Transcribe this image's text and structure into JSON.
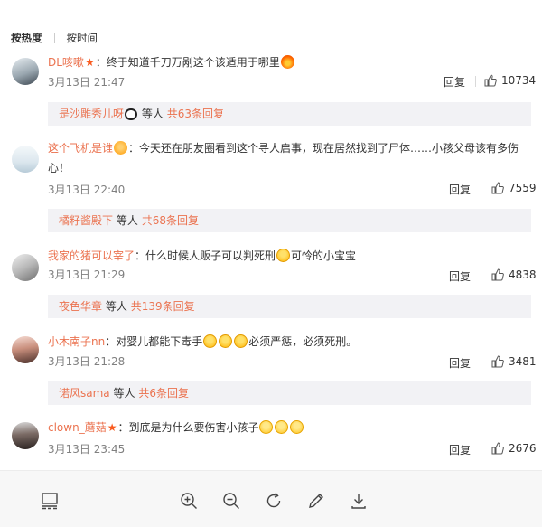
{
  "tabs": {
    "hot": "按热度",
    "time": "按时间"
  },
  "comments": [
    {
      "username": "DL咳嗽",
      "text": "：终于知道千刀万剐这个该适用于哪里",
      "time": "3月13日 21:47",
      "reply_label": "回复",
      "likes": "10734",
      "sub_name": "是沙雕秀儿呀",
      "sub_mid": "等人",
      "sub_more": "共63条回复"
    },
    {
      "username": "这个飞机是谁",
      "text": "：今天还在朋友圈看到这个寻人启事，现在居然找到了尸体……小孩父母该有多伤心！",
      "time": "3月13日 22:40",
      "reply_label": "回复",
      "likes": "7559",
      "sub_name": "橘籽酱殿下",
      "sub_mid": "等人",
      "sub_more": "共68条回复"
    },
    {
      "username": "我家的猪可以宰了",
      "text": "：什么时候人贩子可以判死刑",
      "text2": "可怜的小宝宝",
      "time": "3月13日 21:29",
      "reply_label": "回复",
      "likes": "4838",
      "sub_name": "夜色华章",
      "sub_mid": "等人",
      "sub_more": "共139条回复"
    },
    {
      "username": "小木南子nn",
      "text": "：对婴儿都能下毒手",
      "text2": "必须严惩，必须死刑。",
      "time": "3月13日 21:28",
      "reply_label": "回复",
      "likes": "3481",
      "sub_name": "诺风sama",
      "sub_mid": "等人",
      "sub_more": "共6条回复"
    },
    {
      "username": "clown_蘑菇",
      "text": "：到底是为什么要伤害小孩子",
      "time": "3月13日 23:45",
      "reply_label": "回复",
      "likes": "2676"
    }
  ],
  "toolbar": {
    "icons": [
      "layout-icon",
      "zoom-in-icon",
      "zoom-out-icon",
      "rotate-icon",
      "edit-icon",
      "download-icon"
    ]
  }
}
